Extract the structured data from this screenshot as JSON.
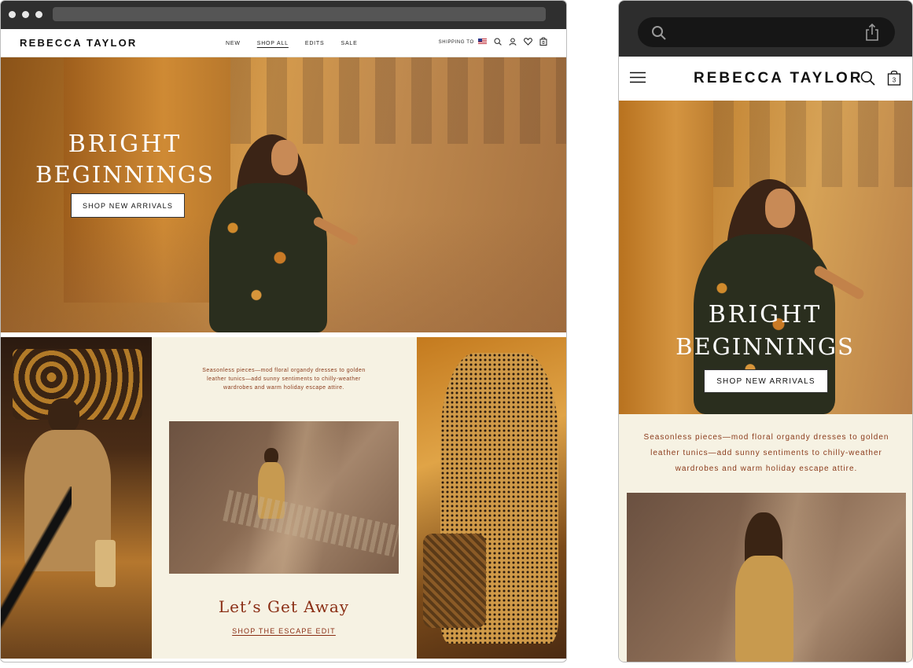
{
  "desktop": {
    "nav": {
      "logo": "REBECCA TAYLOR",
      "menu": [
        "NEW",
        "SHOP ALL",
        "EDITS",
        "SALE"
      ],
      "active_item": "SHOP ALL",
      "shipping_label": "SHIPPING TO",
      "icons": [
        "flag-icon",
        "search-icon",
        "account-icon",
        "wishlist-heart-icon",
        "cart-bag-icon"
      ]
    },
    "hero": {
      "title_line1": "BRIGHT",
      "title_line2": "BEGINNINGS",
      "cta": "SHOP NEW ARRIVALS"
    },
    "feature": {
      "description": "Seasonless pieces—mod floral organdy dresses to golden leather tunics—add sunny sentiments to chilly-weather wardrobes and warm holiday escape attire.",
      "title": "Let’s Get Away",
      "link": "SHOP THE ESCAPE EDIT"
    }
  },
  "mobile": {
    "nav": {
      "logo": "REBECCA TAYLOR",
      "bag_count": "3",
      "icons": [
        "hamburger-menu-icon",
        "search-icon",
        "cart-bag-icon"
      ]
    },
    "hero": {
      "title_line1": "BRIGHT",
      "title_line2": "BEGINNINGS",
      "cta": "SHOP NEW ARRIVALS"
    },
    "feature": {
      "description": "Seasonless pieces—mod floral organdy dresses to golden leather tunics—add sunny sentiments to chilly-weather wardrobes and warm holiday escape attire."
    }
  },
  "colors": {
    "accent_text": "#8a2e14",
    "cream_bg": "#f6f2e3",
    "hero_gold": "#c88c3c"
  }
}
